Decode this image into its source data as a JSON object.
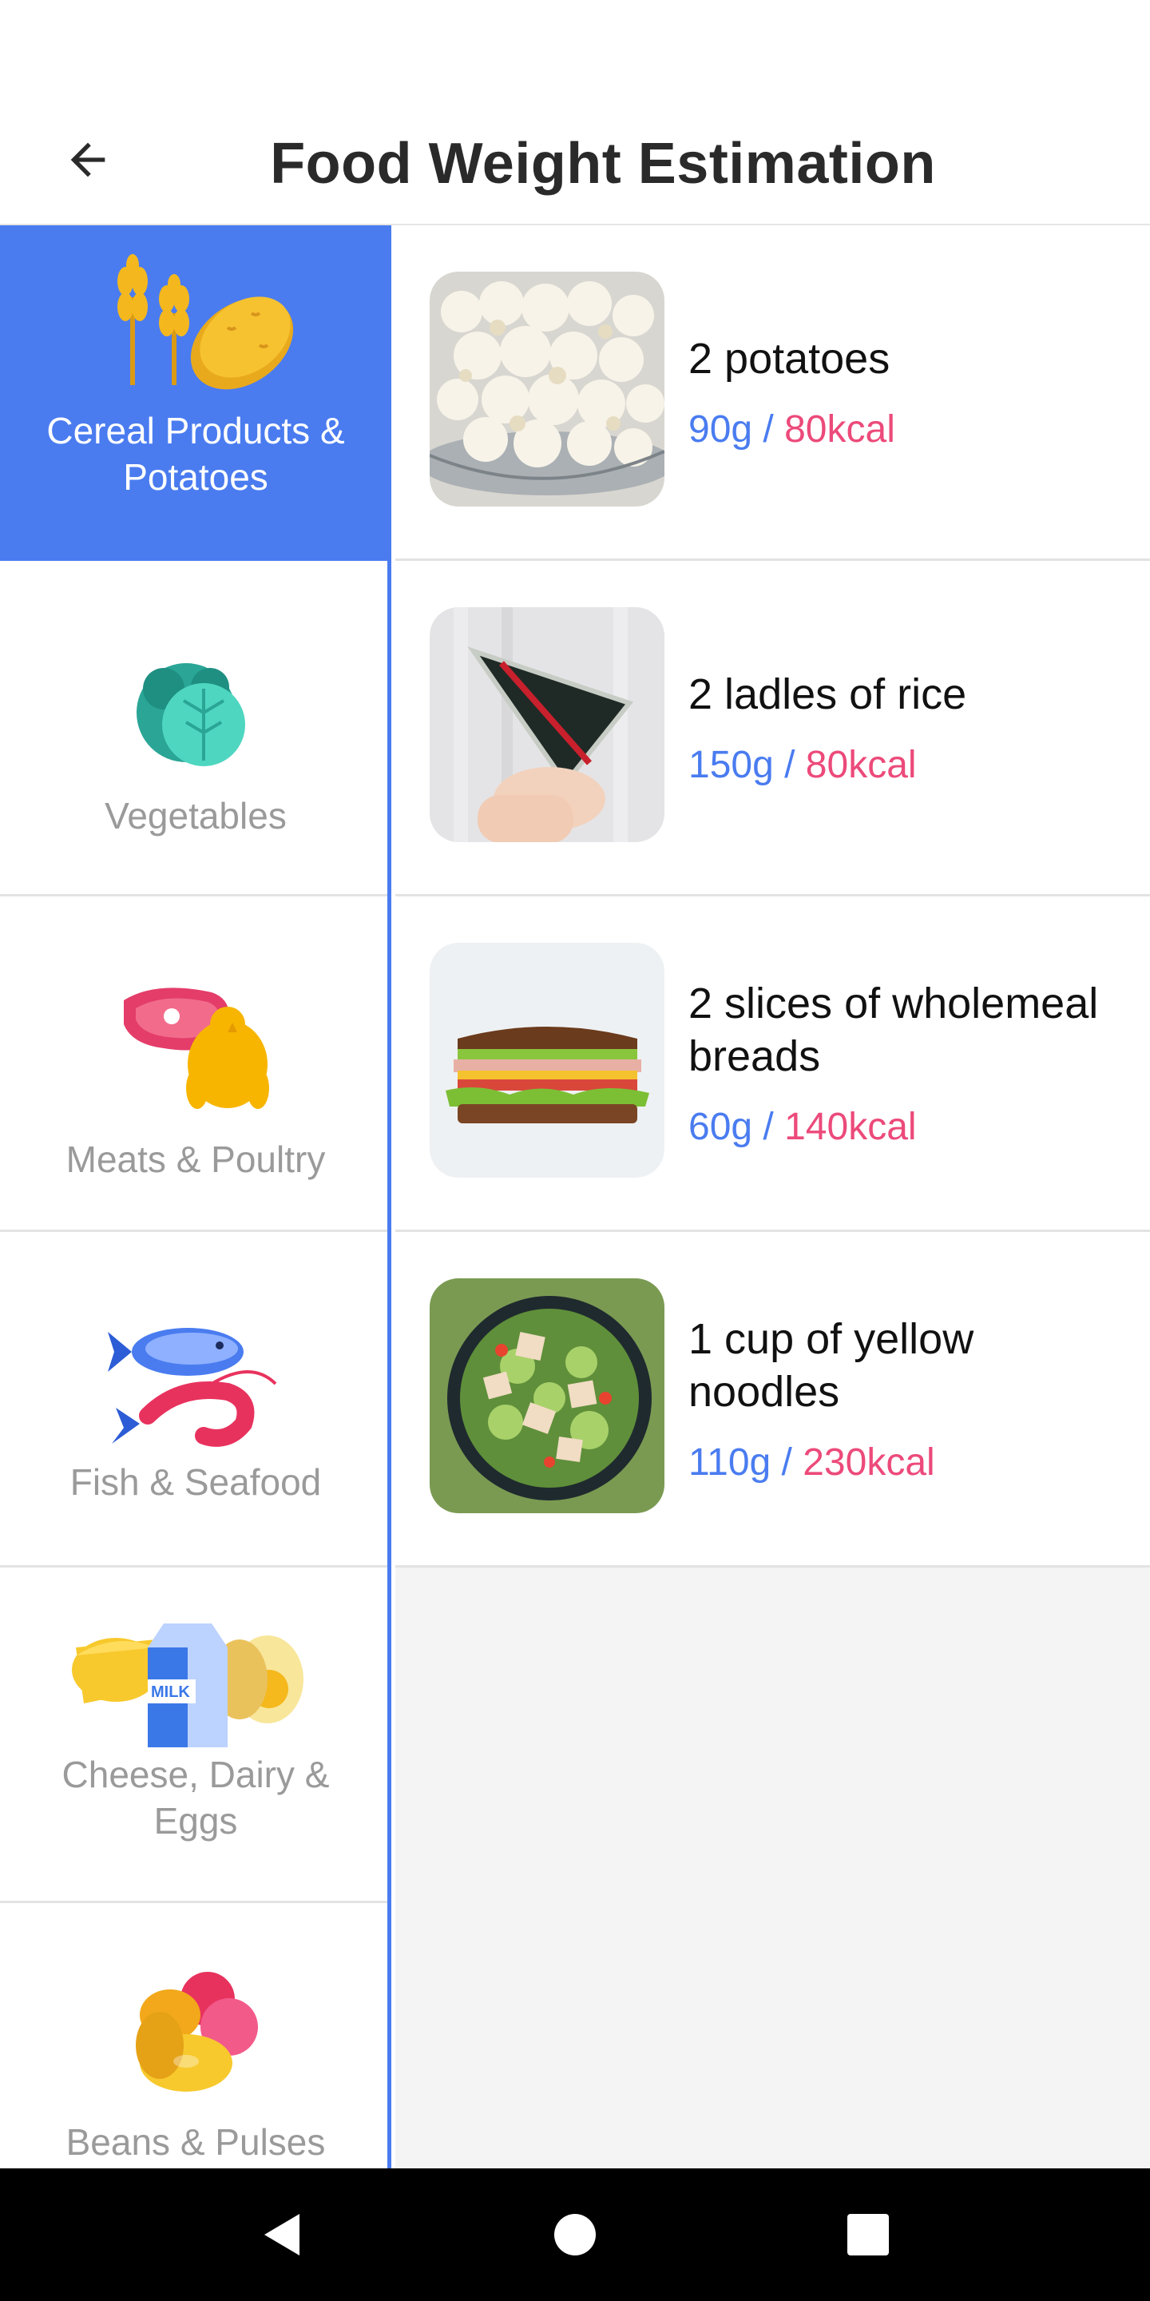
{
  "header": {
    "title": "Food Weight Estimation"
  },
  "categories": [
    {
      "label": "Cereal Products & Potatoes",
      "icon": "cereal-potato-icon",
      "active": true
    },
    {
      "label": "Vegetables",
      "icon": "cabbage-icon",
      "active": false
    },
    {
      "label": "Meats & Poultry",
      "icon": "meat-poultry-icon",
      "active": false
    },
    {
      "label": "Fish & Seafood",
      "icon": "fish-shrimp-icon",
      "active": false
    },
    {
      "label": "Cheese, Dairy & Eggs",
      "icon": "cheese-milk-egg-icon",
      "active": false,
      "milk_text": "MILK"
    },
    {
      "label": "Beans & Pulses",
      "icon": "beans-icon",
      "active": false
    }
  ],
  "items": [
    {
      "name": "2 potatoes",
      "weight": "90g",
      "separator": " / ",
      "kcal": "80kcal",
      "image": "popcorn-bowl-image"
    },
    {
      "name": "2 ladles of rice",
      "weight": "150g",
      "separator": " / ",
      "kcal": "80kcal",
      "image": "onigiri-image"
    },
    {
      "name": "2 slices of wholemeal breads",
      "weight": "60g",
      "separator": " / ",
      "kcal": "140kcal",
      "image": "sandwich-image"
    },
    {
      "name": "1 cup of yellow noodles",
      "weight": "110g",
      "separator": " / ",
      "kcal": "230kcal",
      "image": "salad-bowl-image"
    }
  ],
  "colors": {
    "accent": "#4a7cf0",
    "kcal": "#ec4a7a",
    "inactive_label": "#9a9a9a"
  },
  "nav": {
    "back": "back-triangle-icon",
    "home": "home-circle-icon",
    "recents": "recents-square-icon"
  }
}
